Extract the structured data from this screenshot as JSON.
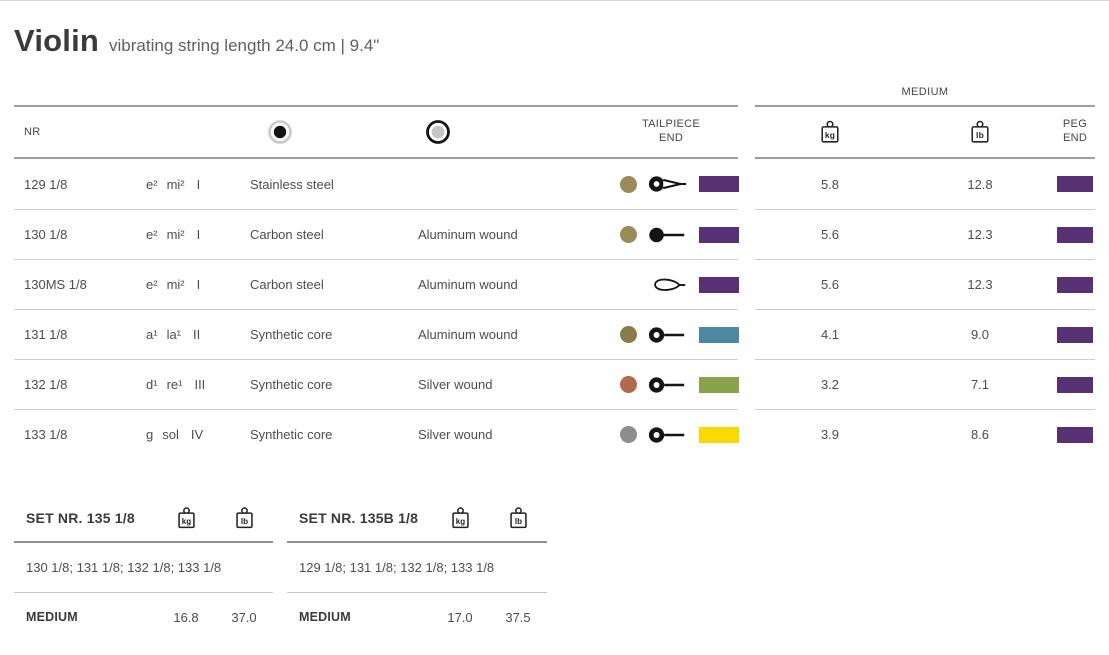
{
  "page": {
    "title": "Violin",
    "subtitle": "vibrating string length 24.0 cm | 9.4\""
  },
  "table": {
    "nr_label": "NR",
    "core_column_icon": "filled-dot-in-gray-ring",
    "winding_column_icon": "gray-dot-in-black-ring",
    "tailpiece_line1": "TAILPIECE",
    "tailpiece_line2": "END",
    "medium_label": "MEDIUM",
    "kg_label": "kg",
    "lb_label": "lb",
    "peg_line1": "PEG",
    "peg_line2": "END",
    "rows": [
      {
        "nr": "129 1/8",
        "note": "e²",
        "solfege": "mi²",
        "roman": "I",
        "core": "Stainless steel",
        "winding": "",
        "dot_color": "#9c8a57",
        "end_type": "ball-loop",
        "tailpiece_color": "#573173",
        "kg": "5.8",
        "lb": "12.8",
        "peg_color": "#573173"
      },
      {
        "nr": "130 1/8",
        "note": "e²",
        "solfege": "mi²",
        "roman": "I",
        "core": "Carbon steel",
        "winding": "Aluminum wound",
        "dot_color": "#9c8a57",
        "end_type": "ball",
        "tailpiece_color": "#573173",
        "kg": "5.6",
        "lb": "12.3",
        "peg_color": "#573173"
      },
      {
        "nr": "130MS 1/8",
        "note": "e²",
        "solfege": "mi²",
        "roman": "I",
        "core": "Carbon steel",
        "winding": "Aluminum wound",
        "dot_color": null,
        "end_type": "loop",
        "tailpiece_color": "#573173",
        "kg": "5.6",
        "lb": "12.3",
        "peg_color": "#573173"
      },
      {
        "nr": "131 1/8",
        "note": "a¹",
        "solfege": "la¹",
        "roman": "II",
        "core": "Synthetic core",
        "winding": "Aluminum wound",
        "dot_color": "#8b7b46",
        "end_type": "ring",
        "tailpiece_color": "#4d87a0",
        "kg": "4.1",
        "lb": "9.0",
        "peg_color": "#573173"
      },
      {
        "nr": "132 1/8",
        "note": "d¹",
        "solfege": "re¹",
        "roman": "III",
        "core": "Synthetic core",
        "winding": "Silver wound",
        "dot_color": "#b06b4c",
        "end_type": "ring",
        "tailpiece_color": "#85a44b",
        "kg": "3.2",
        "lb": "7.1",
        "peg_color": "#573173"
      },
      {
        "nr": "133 1/8",
        "note": "g",
        "solfege": "sol",
        "roman": "IV",
        "core": "Synthetic core",
        "winding": "Silver wound",
        "dot_color": "#8d8d8d",
        "end_type": "ring",
        "tailpiece_color": "#f8d800",
        "kg": "3.9",
        "lb": "8.6",
        "peg_color": "#573173"
      }
    ]
  },
  "sets": [
    {
      "title": "SET NR. 135 1/8",
      "contents": "130 1/8; 131 1/8; 132 1/8; 133 1/8",
      "gauge_label": "MEDIUM",
      "kg": "16.8",
      "lb": "37.0"
    },
    {
      "title": "SET NR. 135B 1/8",
      "contents": "129 1/8; 131 1/8; 132 1/8; 133 1/8",
      "gauge_label": "MEDIUM",
      "kg": "17.0",
      "lb": "37.5"
    }
  ],
  "colors": {
    "accent_purple": "#573173",
    "tailpiece_blue": "#4d87a0",
    "tailpiece_green": "#85a44b",
    "tailpiece_yellow": "#f8d800"
  }
}
